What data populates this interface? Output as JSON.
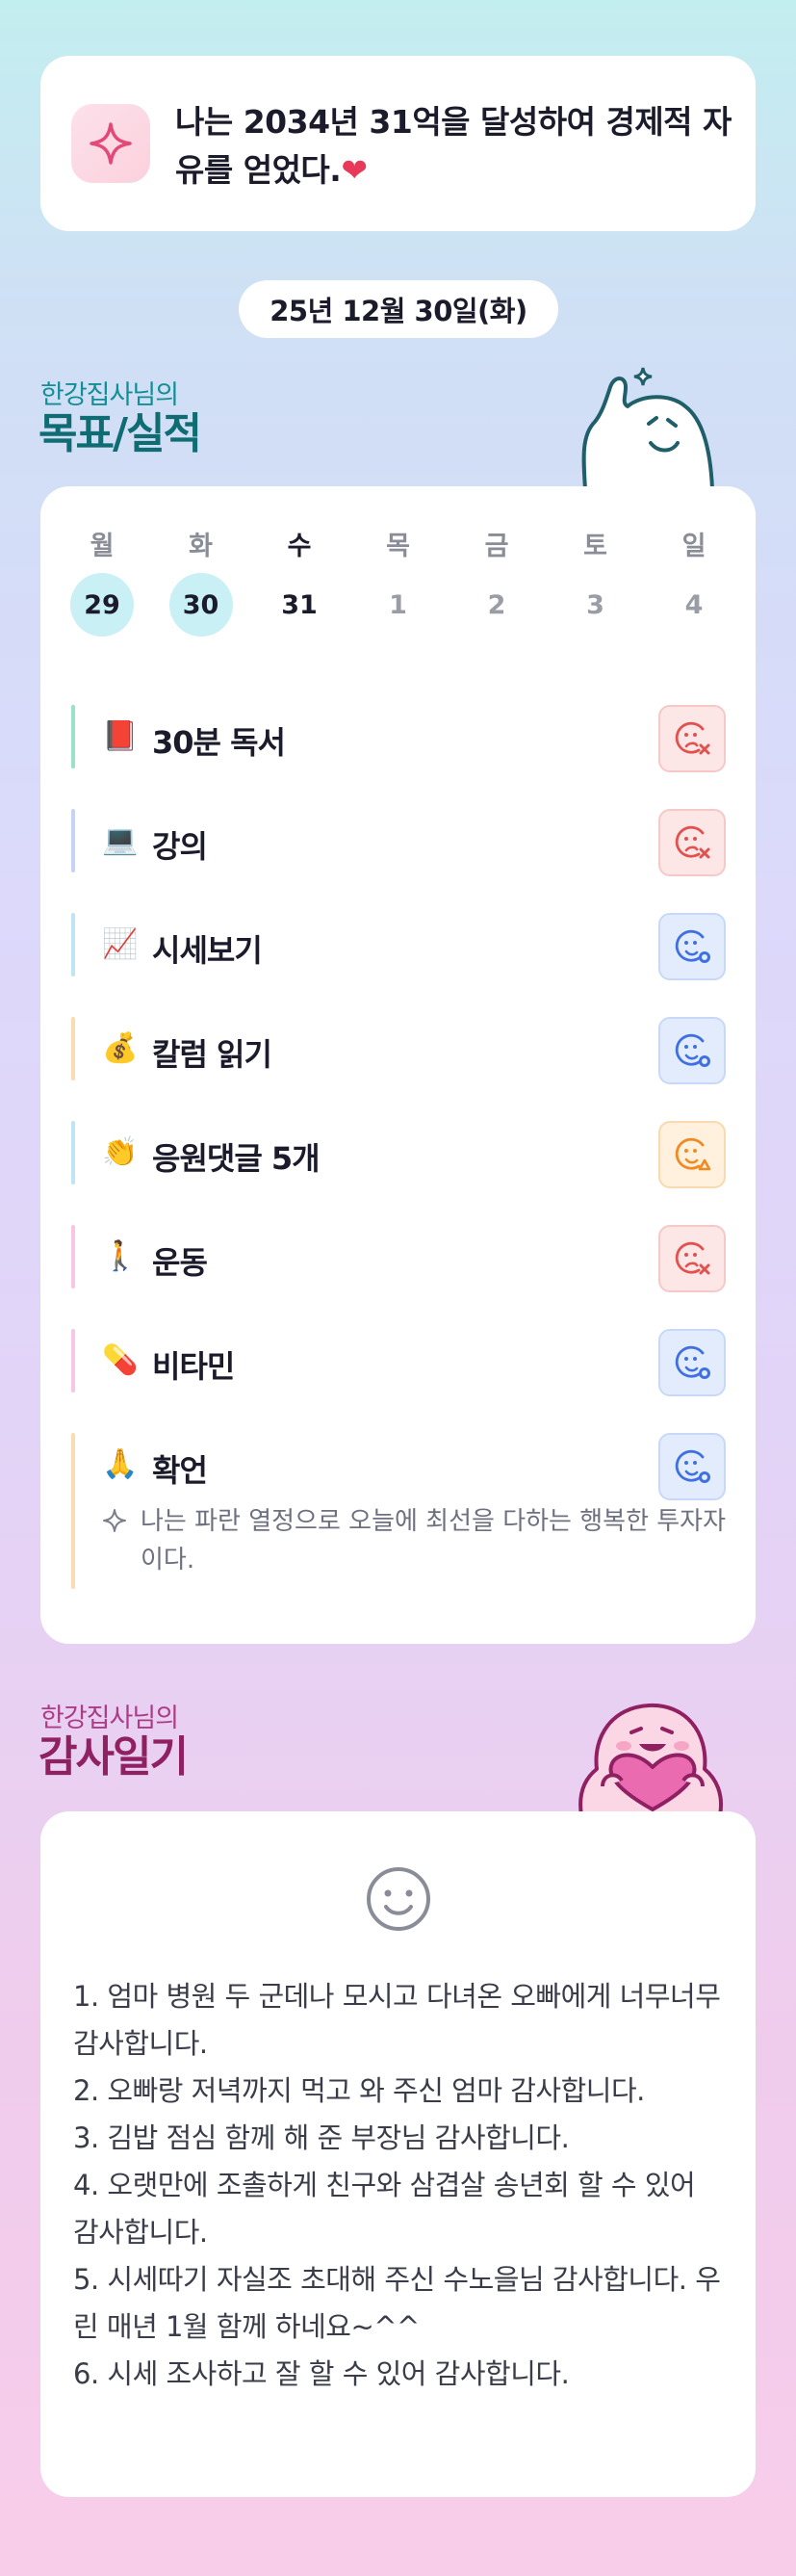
{
  "goal": {
    "text": "나는 2034년 31억을 달성하여 경제적 자유를 얻었다.",
    "heart": "❤",
    "icon": "sparkle-icon"
  },
  "date": "25년 12월 30일(화)",
  "goals_section": {
    "subtitle": "한강집사님의",
    "title": "목표/실적"
  },
  "week": [
    {
      "dow": "월",
      "num": "29",
      "state": "done"
    },
    {
      "dow": "화",
      "num": "30",
      "state": "done"
    },
    {
      "dow": "수",
      "num": "31",
      "state": "today"
    },
    {
      "dow": "목",
      "num": "1",
      "state": "future"
    },
    {
      "dow": "금",
      "num": "2",
      "state": "future"
    },
    {
      "dow": "토",
      "num": "3",
      "state": "future"
    },
    {
      "dow": "일",
      "num": "4",
      "state": "future"
    }
  ],
  "habits": [
    {
      "emoji": "📕",
      "label": "30분 독서",
      "status": "fail",
      "bar_color": "#9be0c8"
    },
    {
      "emoji": "💻",
      "label": "강의",
      "status": "fail",
      "bar_color": "#c7d3f4"
    },
    {
      "emoji": "📈",
      "label": "시세보기",
      "status": "ok",
      "bar_color": "#bfe4f2"
    },
    {
      "emoji": "💰",
      "label": "칼럼 읽기",
      "status": "ok",
      "bar_color": "#f9dcb2"
    },
    {
      "emoji": "👏",
      "label": "응원댓글 5개",
      "status": "partial",
      "bar_color": "#bfe4f2"
    },
    {
      "emoji": "🚶",
      "label": "운동",
      "status": "fail",
      "bar_color": "#f5c7e4"
    },
    {
      "emoji": "💊",
      "label": "비타민",
      "status": "ok",
      "bar_color": "#f5c7e4"
    },
    {
      "emoji": "🙏",
      "label": "확언",
      "status": "ok",
      "bar_color": "#f9dcb2"
    }
  ],
  "affirmation": "나는 파란 열정으로 오늘에 최선을 다하는 행복한 투자자이다.",
  "thanks_section": {
    "subtitle": "한강집사님의",
    "title": "감사일기"
  },
  "thanks": [
    "1. 엄마 병원 두 군데나 모시고 다녀온 오빠에게 너무너무 감사합니다.",
    "2. 오빠랑 저녁까지 먹고 와 주신 엄마 감사합니다.",
    "3. 김밥 점심 함께 해 준 부장님 감사합니다.",
    "4. 오랫만에 조촐하게 친구와 삼겹살 송년회 할 수 있어 감사합니다.",
    "5. 시세따기 자실조 초대해 주신 수노을님 감사합니다. 우린 매년 1월 함께 하네요~^^",
    "6. 시세 조사하고 잘 할 수 있어 감사합니다."
  ]
}
